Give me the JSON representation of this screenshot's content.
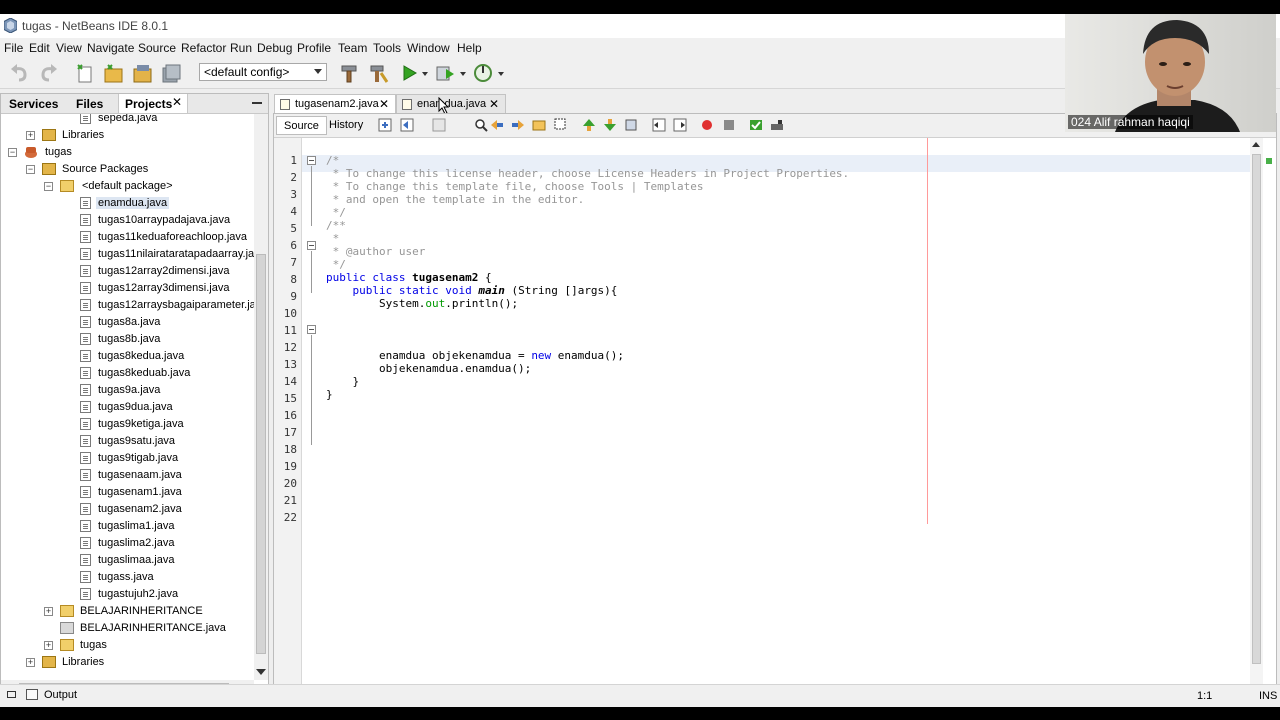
{
  "window": {
    "title": "tugas - NetBeans IDE 8.0.1"
  },
  "menu": [
    "File",
    "Edit",
    "View",
    "Navigate",
    "Source",
    "Refactor",
    "Run",
    "Debug",
    "Profile",
    "Team",
    "Tools",
    "Window",
    "Help"
  ],
  "toolbar": {
    "config": "<default config>"
  },
  "left_panel": {
    "tabs": [
      "Services",
      "Files",
      "Projects"
    ],
    "tree": [
      {
        "label": "sepeda.java",
        "type": "file"
      },
      {
        "label": "Libraries",
        "type": "lib"
      },
      {
        "label": "tugas",
        "type": "project"
      },
      {
        "label": "Source Packages",
        "type": "src"
      },
      {
        "label": "<default package>",
        "type": "pkg"
      },
      {
        "label": "enamdua.java",
        "type": "file",
        "selected": true
      },
      {
        "label": "tugas10arraypadajava.java",
        "type": "file"
      },
      {
        "label": "tugas11keduaforeachloop.java",
        "type": "file"
      },
      {
        "label": "tugas11nilairataratapadaarray.java",
        "type": "file"
      },
      {
        "label": "tugas12array2dimensi.java",
        "type": "file"
      },
      {
        "label": "tugas12array3dimensi.java",
        "type": "file"
      },
      {
        "label": "tugas12arraysbagaiparameter.java",
        "type": "file"
      },
      {
        "label": "tugas8a.java",
        "type": "file"
      },
      {
        "label": "tugas8b.java",
        "type": "file"
      },
      {
        "label": "tugas8kedua.java",
        "type": "file"
      },
      {
        "label": "tugas8keduab.java",
        "type": "file"
      },
      {
        "label": "tugas9a.java",
        "type": "file"
      },
      {
        "label": "tugas9dua.java",
        "type": "file"
      },
      {
        "label": "tugas9ketiga.java",
        "type": "file"
      },
      {
        "label": "tugas9satu.java",
        "type": "file"
      },
      {
        "label": "tugas9tigab.java",
        "type": "file"
      },
      {
        "label": "tugasenaam.java",
        "type": "file"
      },
      {
        "label": "tugasenam1.java",
        "type": "file"
      },
      {
        "label": "tugasenam2.java",
        "type": "file"
      },
      {
        "label": "tugaslima1.java",
        "type": "file"
      },
      {
        "label": "tugaslima2.java",
        "type": "file"
      },
      {
        "label": "tugaslimaa.java",
        "type": "file"
      },
      {
        "label": "tugass.java",
        "type": "file"
      },
      {
        "label": "tugastujuh2.java",
        "type": "file"
      },
      {
        "label": "BELAJARINHERITANCE",
        "type": "pkg"
      },
      {
        "label": "BELAJARINHERITANCE.java",
        "type": "file"
      },
      {
        "label": "tugas",
        "type": "pkg"
      },
      {
        "label": "Libraries",
        "type": "lib"
      }
    ]
  },
  "editor": {
    "tabs": [
      {
        "label": "tugasenam2.java",
        "active": true
      },
      {
        "label": "enamdua.java",
        "active": false
      }
    ],
    "view_buttons": [
      "Source",
      "History"
    ],
    "lines": [
      "1",
      "2",
      "3",
      "4",
      "5",
      "6",
      "7",
      "8",
      "9",
      "10",
      "11",
      "12",
      "13",
      "14",
      "15",
      "16",
      "17",
      "18",
      "19",
      "20",
      "21",
      "22"
    ]
  },
  "status": {
    "output": "Output",
    "position": "1:1",
    "mode": "INS"
  },
  "webcam": {
    "name": "024 Alif rahman haqiqi"
  }
}
